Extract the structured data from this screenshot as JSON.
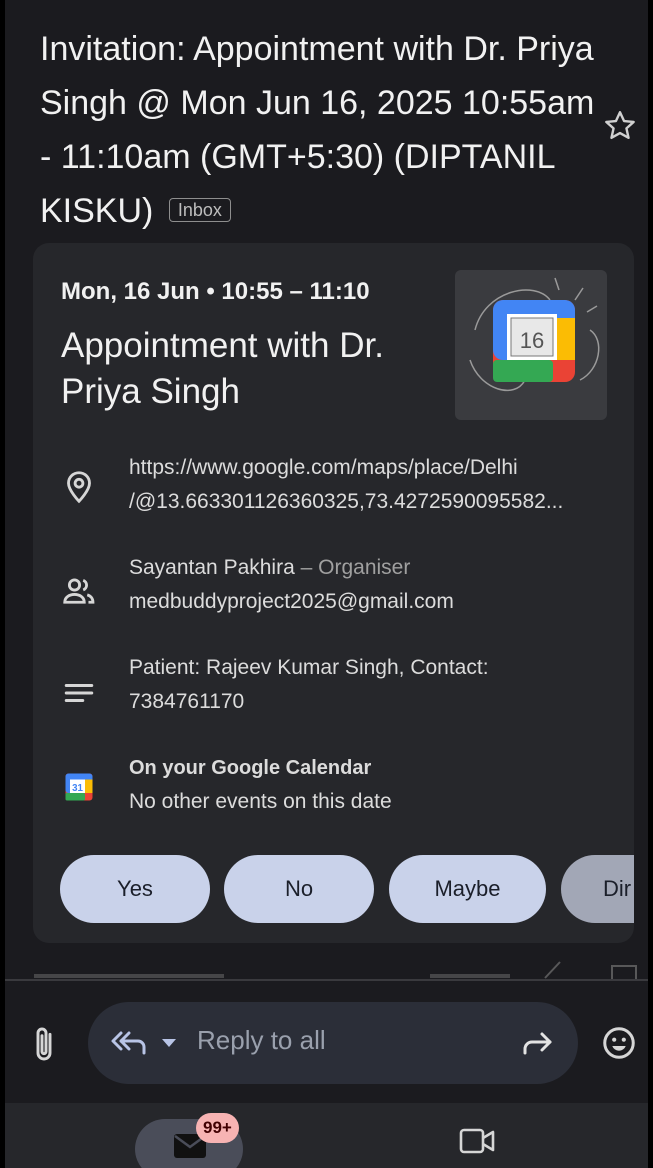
{
  "email": {
    "subject": "Invitation: Appointment with Dr. Priya Singh @ Mon Jun 16, 2025 10:55am - 11:10am (GMT+5:30) (DIPTANIL KISKU)",
    "label": "Inbox"
  },
  "invite": {
    "date_time": "Mon, 16 Jun • 10:55 – 11:10",
    "title": "Appointment with Dr. Priya Singh",
    "calendar_day": "16",
    "location": {
      "line1": "https://www.google.com/maps/place/Delhi",
      "line2": "/@13.663301126360325,73.4272590095582..."
    },
    "organiser": {
      "name": "Sayantan Pakhira",
      "role": " – Organiser",
      "email": "medbuddyproject2025@gmail.com"
    },
    "description": {
      "line1": "Patient: Rajeev Kumar Singh, Contact:",
      "line2": "7384761170"
    },
    "calendar": {
      "icon_number": "31",
      "heading": "On your Google Calendar",
      "text": "No other events on this date"
    },
    "rsvp": {
      "yes": "Yes",
      "no": "No",
      "maybe": "Maybe",
      "more": "Dir"
    }
  },
  "reply": {
    "placeholder": "Reply to all"
  },
  "nav": {
    "mail_badge": "99+"
  },
  "colors": {
    "background": "#1b1b1f",
    "card": "#26272b",
    "rsvp_button": "#c9d2ea",
    "badge": "#f7b3b3"
  }
}
